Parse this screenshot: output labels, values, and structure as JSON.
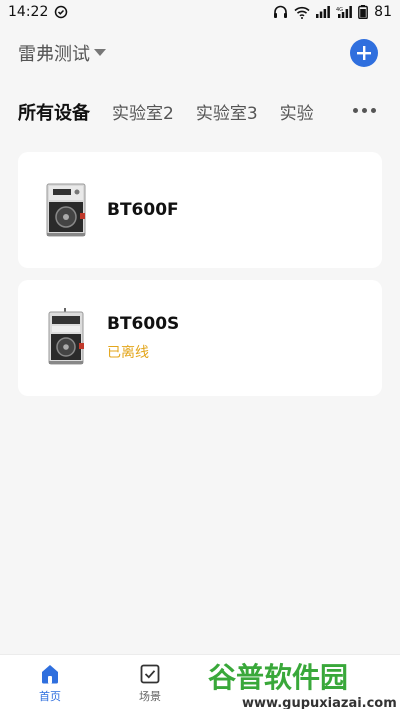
{
  "status_bar": {
    "time": "14:22",
    "battery": "81",
    "network": "4G"
  },
  "header": {
    "home_name": "雷弗测试",
    "add_icon": "plus-circle-icon",
    "accent_color": "#2f6fde"
  },
  "tabs": [
    {
      "label": "所有设备",
      "active": true
    },
    {
      "label": "实验室2",
      "active": false
    },
    {
      "label": "实验室3",
      "active": false
    },
    {
      "label": "实验",
      "active": false
    }
  ],
  "devices": [
    {
      "name": "BT600F",
      "status": ""
    },
    {
      "name": "BT600S",
      "status": "已离线"
    }
  ],
  "bottom_nav": [
    {
      "label": "首页",
      "icon": "home-icon",
      "active": true
    },
    {
      "label": "场景",
      "icon": "checkbox-icon",
      "active": false
    }
  ],
  "watermark": {
    "title": "谷普软件园",
    "url": "www.gupuxiazai.com"
  }
}
